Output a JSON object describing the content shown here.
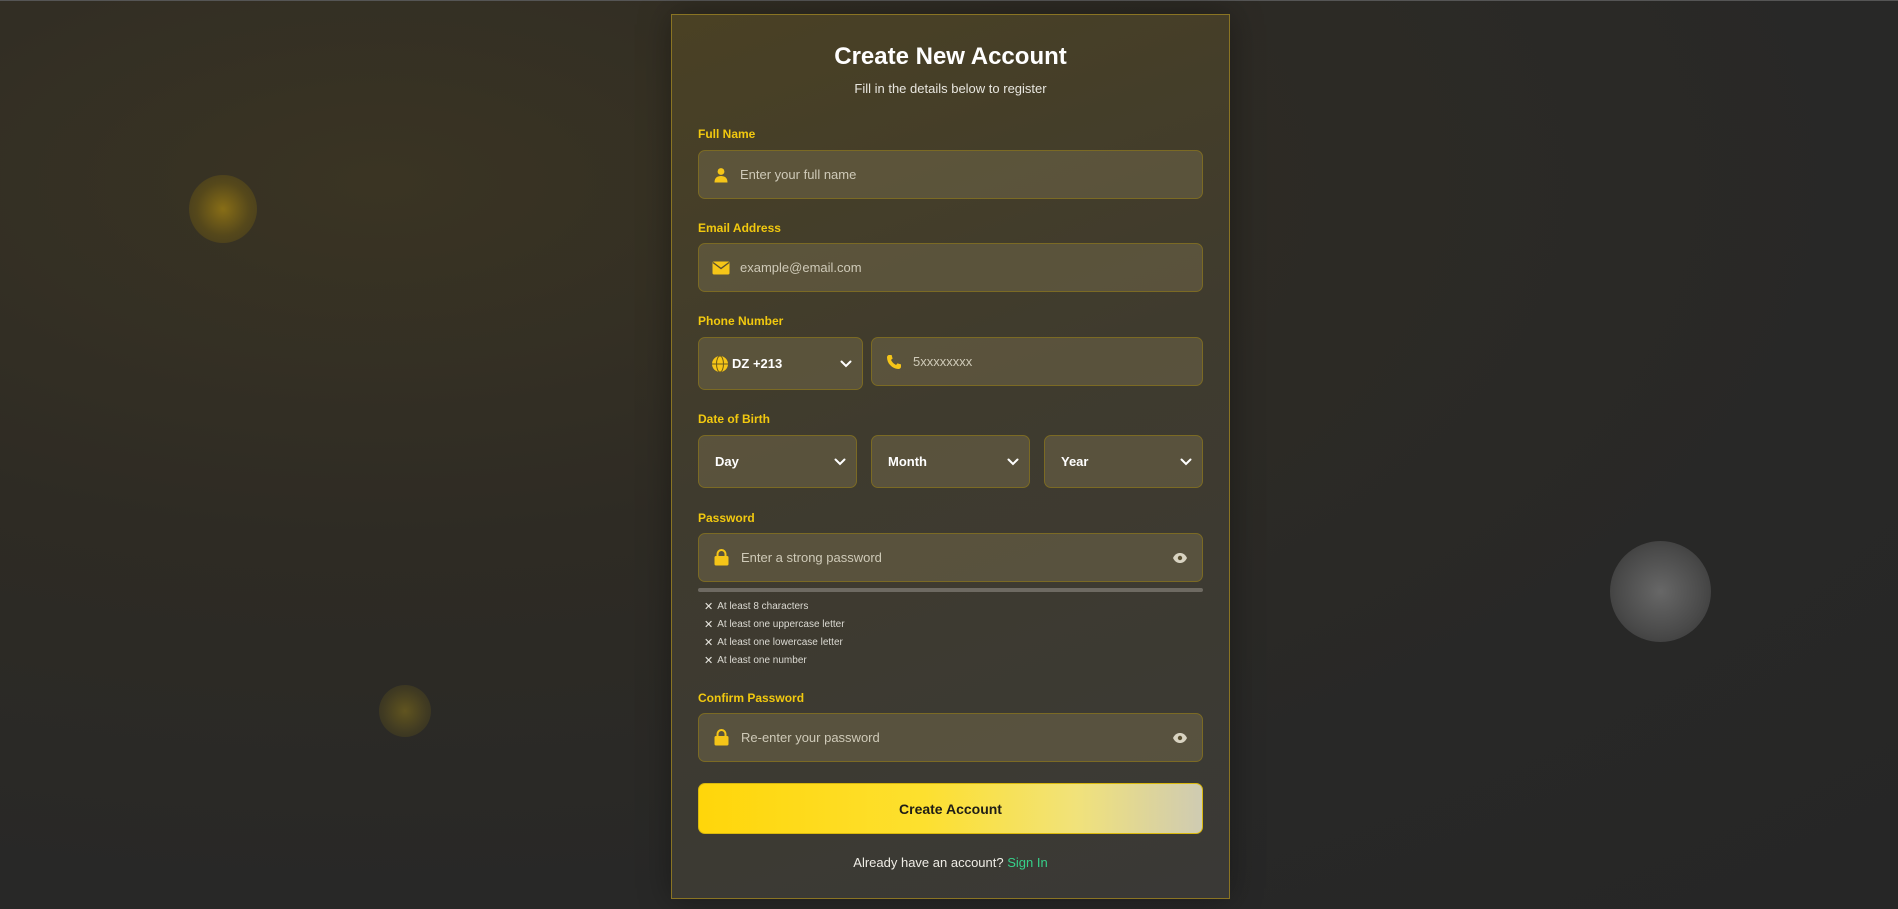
{
  "form": {
    "title": "Create New Account",
    "subtitle": "Fill in the details below to register",
    "full_name": {
      "label": "Full Name",
      "placeholder": "Enter your full name",
      "icon": "user-icon"
    },
    "email": {
      "label": "Email Address",
      "placeholder": "example@email.com",
      "icon": "envelope-icon"
    },
    "phone": {
      "label": "Phone Number",
      "country_code": "DZ +213",
      "country_icon": "globe-icon",
      "placeholder": "5xxxxxxxx",
      "icon": "phone-icon"
    },
    "dob": {
      "label": "Date of Birth",
      "day": "Day",
      "month": "Month",
      "year": "Year"
    },
    "password": {
      "label": "Password",
      "placeholder": "Enter a strong password",
      "icon": "lock-icon",
      "toggle_icon": "eye-icon",
      "requirements": [
        "At least 8 characters",
        "At least one uppercase letter",
        "At least one lowercase letter",
        "At least one number"
      ],
      "requirement_mark": "✕"
    },
    "confirm_password": {
      "label": "Confirm Password",
      "placeholder": "Re-enter your password",
      "icon": "lock-icon",
      "toggle_icon": "eye-icon"
    },
    "submit_label": "Create Account",
    "signin_prompt": "Already have an account?",
    "signin_link": "Sign In"
  },
  "colors": {
    "accent": "#f5c518",
    "link": "#36d08a",
    "card_border": "#8a7423"
  }
}
